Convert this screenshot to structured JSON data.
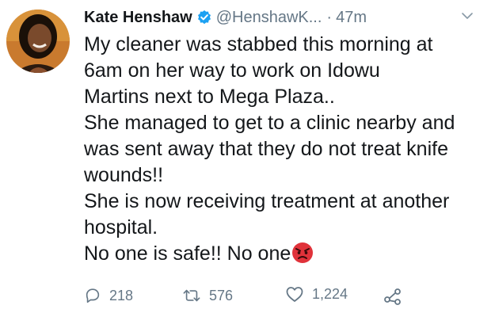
{
  "tweet": {
    "display_name": "Kate Henshaw",
    "handle": "@HenshawK...",
    "separator": "·",
    "time": "47m",
    "lines": [
      "My cleaner was stabbed this morning at",
      "6am on her way to work on Idowu",
      "Martins next to Mega Plaza..",
      "She managed to get to a clinic nearby and",
      "was sent away that they do not treat knife",
      "wounds!!",
      "She is now receiving treatment at another",
      "hospital.",
      "No one is safe!! No one"
    ],
    "emoji": "angry-face",
    "verified_icon": "verified-badge-icon",
    "colors": {
      "text": "#14171a",
      "secondary": "#657786",
      "verified": "#1da1f2",
      "emoji": "#e0323a"
    }
  },
  "actions": {
    "reply_count": "218",
    "retweet_count": "576",
    "like_count": "1,224",
    "icons": [
      "reply-icon",
      "retweet-icon",
      "like-icon",
      "share-icon"
    ]
  }
}
